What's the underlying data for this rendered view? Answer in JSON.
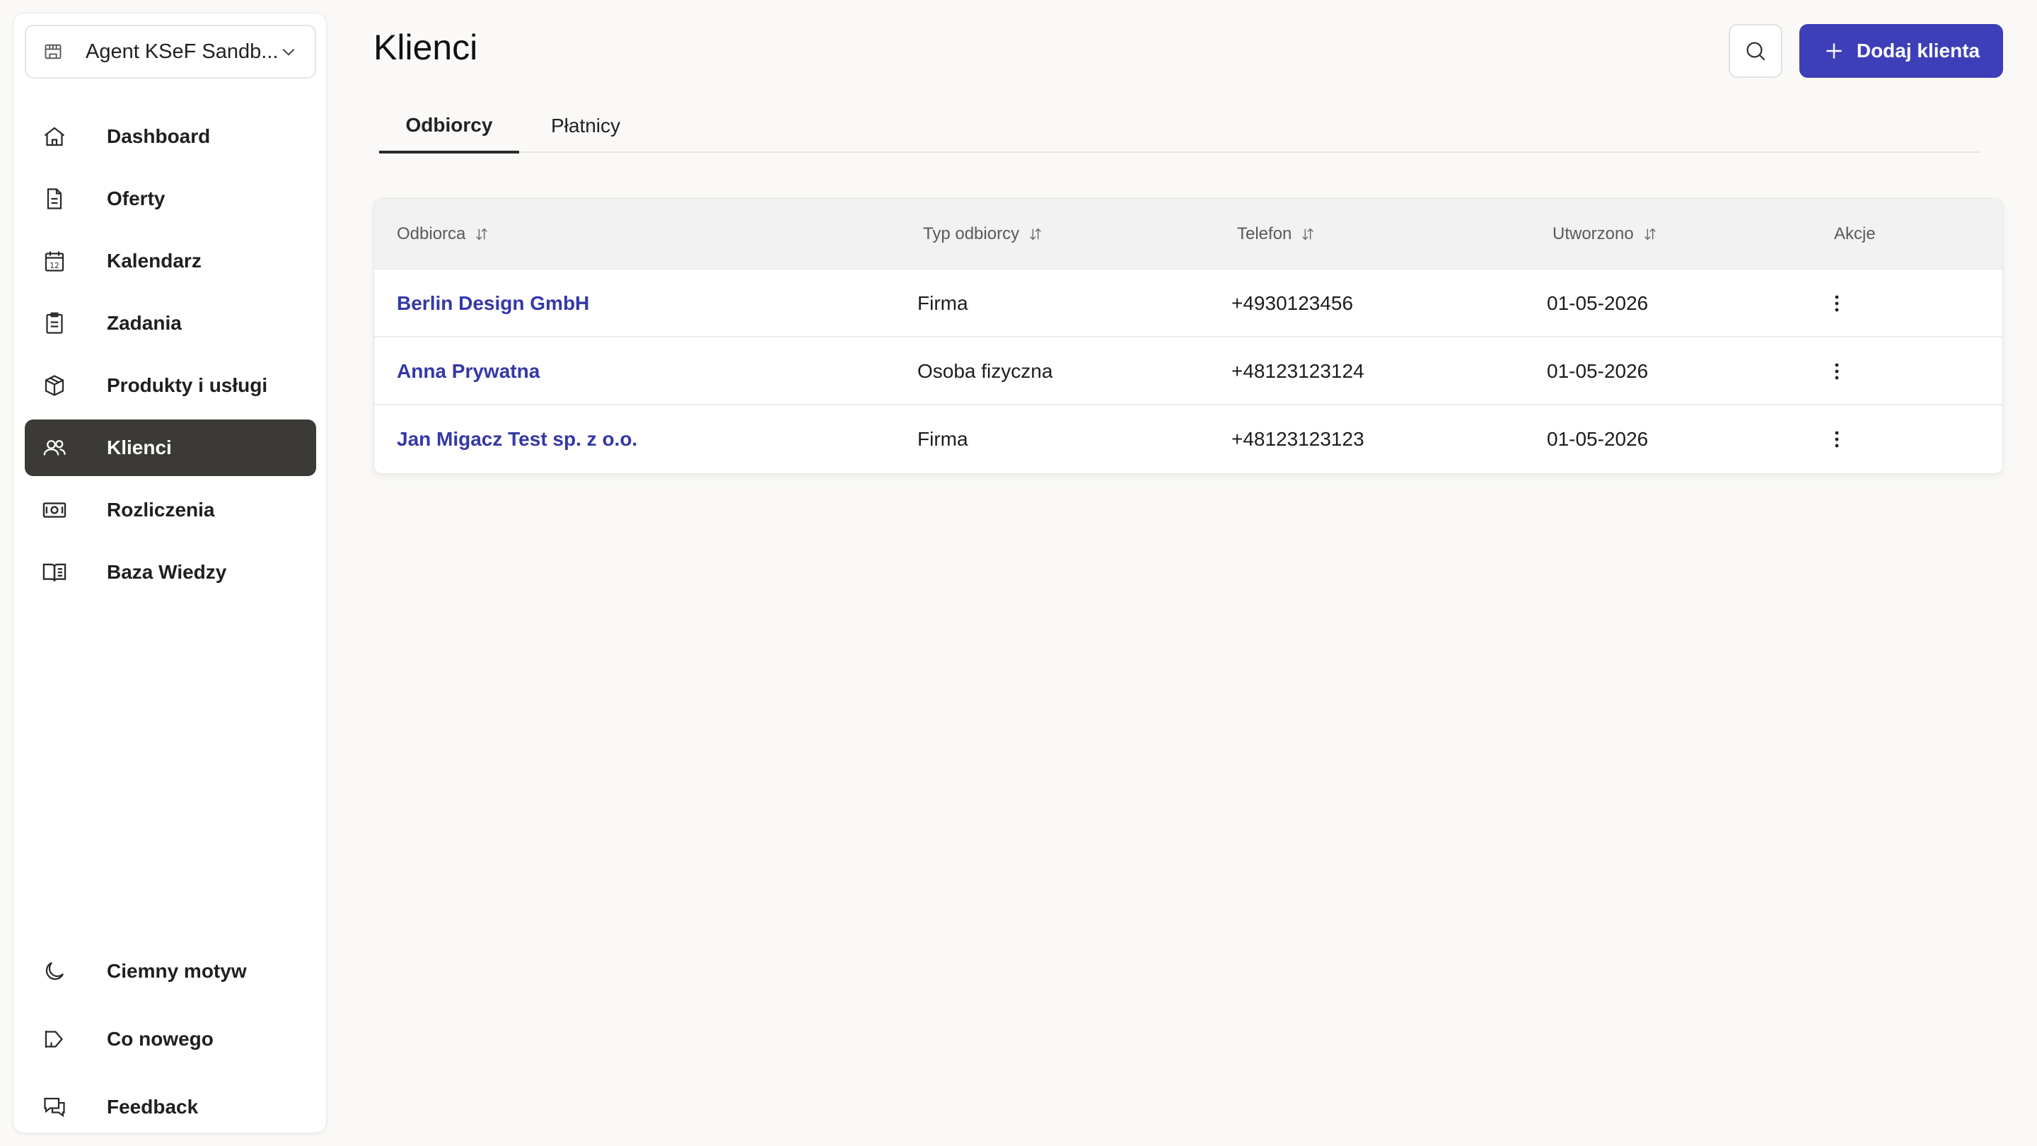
{
  "sidebar": {
    "org_name": "Agent KSeF Sandb...",
    "items": [
      {
        "label": "Dashboard",
        "icon": "home-icon"
      },
      {
        "label": "Oferty",
        "icon": "document-icon"
      },
      {
        "label": "Kalendarz",
        "icon": "calendar-icon"
      },
      {
        "label": "Zadania",
        "icon": "clipboard-icon"
      },
      {
        "label": "Produkty i usługi",
        "icon": "box-icon"
      },
      {
        "label": "Klienci",
        "icon": "users-icon",
        "active": true
      },
      {
        "label": "Rozliczenia",
        "icon": "banknote-icon"
      },
      {
        "label": "Baza Wiedzy",
        "icon": "book-icon"
      }
    ],
    "bottom_items": [
      {
        "label": "Ciemny motyw",
        "icon": "moon-icon"
      },
      {
        "label": "Co nowego",
        "icon": "megaphone-icon"
      },
      {
        "label": "Feedback",
        "icon": "chat-icon"
      }
    ],
    "calendar_day": "12"
  },
  "header": {
    "title": "Klienci",
    "add_button_label": "Dodaj klienta"
  },
  "tabs": [
    {
      "label": "Odbiorcy",
      "active": true
    },
    {
      "label": "Płatnicy",
      "active": false
    }
  ],
  "table": {
    "columns": [
      "Odbiorca",
      "Typ odbiorcy",
      "Telefon",
      "Utworzono",
      "Akcje"
    ],
    "rows": [
      {
        "name": "Berlin Design GmbH",
        "type": "Firma",
        "phone": "+4930123456",
        "created": "01-05-2026"
      },
      {
        "name": "Anna Prywatna",
        "type": "Osoba fizyczna",
        "phone": "+48123123124",
        "created": "01-05-2026"
      },
      {
        "name": "Jan Migacz Test sp. z o.o.",
        "type": "Firma",
        "phone": "+48123123123",
        "created": "01-05-2026"
      }
    ]
  },
  "colors": {
    "accent": "#3d3fb8",
    "link": "#3438a6",
    "active_nav": "#3b3a37",
    "background": "#faf9f7"
  }
}
